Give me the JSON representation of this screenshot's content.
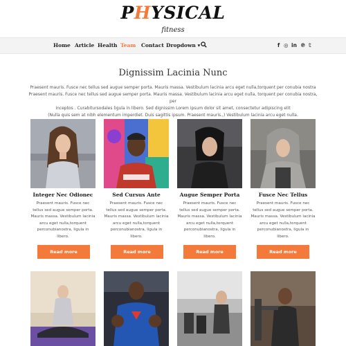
{
  "brand": {
    "part1": "P",
    "accent": "H",
    "part2": "YSICAL",
    "sub": "fitness",
    "accent_color": "#f37a3a"
  },
  "nav": {
    "items": [
      {
        "label": "Home"
      },
      {
        "label": "Article"
      },
      {
        "label": "Health"
      },
      {
        "label": "Team",
        "active": true
      },
      {
        "label": "Contact"
      },
      {
        "label": "Dropdown ▾"
      }
    ],
    "search_icon": "search-icon",
    "social": [
      "f",
      "◎",
      "in",
      "℗",
      "𝕥"
    ]
  },
  "section": {
    "title": "Dignissim Lacinia Nunc",
    "intro_lines": [
      "Praesent mauris. Fusce nec tellus sed augue semper porta. Mauris massa. Vestibulum lacinia arcu eget nulla,torquent per conubia nostra",
      "Praesent mauris. Fusce nec tellus sed augue semper porta. Mauris massa. Vestibulum lacinia arcu eget nulla, torquent per conubia nostra, per",
      "inceptos . Curabitursodales ligula in libero. Sed dignissim Lorem ipsum dolor sit amet, consectetur adipiscing elit",
      "(Nulla quis sem at nibh elementum imperdiet. Duis sagittis ipsum. Praesent mauris.,) Vestibulum lacinia arcu eget nulla."
    ]
  },
  "cards": [
    {
      "title": "Integer Nec Odionec",
      "text_lines": [
        "Praesent mauris. Fusce nec",
        "tellus sed augue semper porta.",
        "Mauris massa. Vestibulum lacinia",
        "arcu eget nulla,torquent",
        "perconubianostra, ligula in",
        "libero."
      ],
      "button": "Read more"
    },
    {
      "title": "Sed Cursus Ante",
      "text_lines": [
        "Praesent mauris. Fusce nec",
        "tellus sed augue semper porta.",
        "Mauris massa. Vestibulum lacinia",
        "arcu eget nulla,torquent",
        "perconubianostra, ligula in",
        "libero."
      ],
      "button": "Read more"
    },
    {
      "title": "Augue Semper Porta",
      "text_lines": [
        "Praesent mauris. Fusce nec",
        "tellus sed augue semper porta.",
        "Mauris massa. Vestibulum lacinia",
        "arcu eget nulla,torquent",
        "perconubianostra, ligula in",
        "libero."
      ],
      "button": "Read more"
    },
    {
      "title": "Fusce Nec Tellus",
      "text_lines": [
        "Praesent mauris. Fusce nec",
        "tellus sed augue semper porta.",
        "Mauris massa. Vestibulum lacinia",
        "arcu eget nulla,torquent",
        "perconubianostra, ligula in",
        "libero."
      ],
      "button": "Read more"
    }
  ]
}
